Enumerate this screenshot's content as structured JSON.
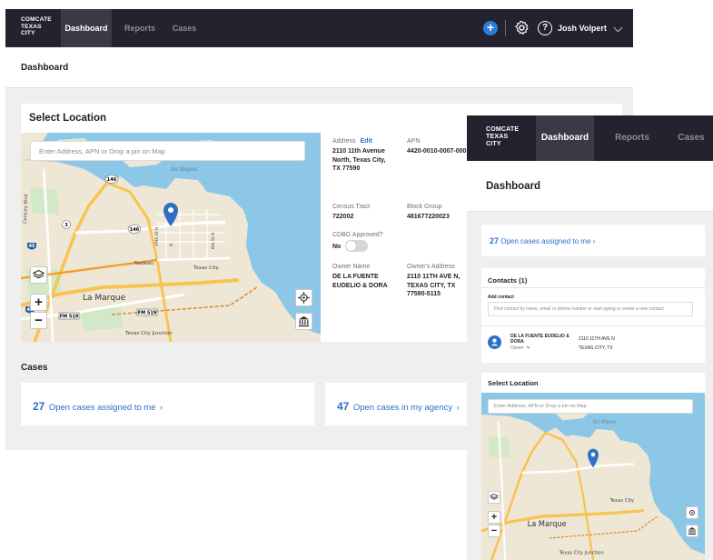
{
  "brand": {
    "line1": "COMCATE",
    "line2": "TEXAS",
    "line3": "CITY"
  },
  "nav": {
    "dashboard": "Dashboard",
    "reports": "Reports",
    "cases": "Cases"
  },
  "user": {
    "name": "Josh Volpert"
  },
  "icons": {
    "add": "plus-circle-icon",
    "settings": "gear-icon",
    "help": "help-circle-icon",
    "menu": "chevron-down-icon"
  },
  "colors": {
    "accent": "#2a6fc9",
    "header_bg": "#23232f",
    "water": "#8cc7e8",
    "land": "#efe7d6"
  },
  "page": {
    "title": "Dashboard"
  },
  "select_location": {
    "title": "Select Location",
    "search_placeholder": "Enter Address, APN or Drop a pin on Map",
    "map_labels": {
      "sis_bayou": "Sis Bayou",
      "la_marque": "La Marque",
      "nadeau": "Nadeau",
      "texas_city": "Texas City",
      "texas_city_junction": "Texas City Junction",
      "century_blvd": "Century Blvd",
      "fm519": "FM 519",
      "fm519b": "FM 519",
      "hwy146": "146",
      "hwy146b": "146",
      "hwy3": "3",
      "i45": "45",
      "i45b": "45",
      "street_29th": "29th St N",
      "street_n": "N",
      "street_6th": "6th St N"
    },
    "zoom_in": "+",
    "zoom_out": "−",
    "layers_icon": "layers-icon",
    "locate_icon": "crosshair-icon",
    "parcel_icon": "building-icon"
  },
  "property": {
    "address_label": "Address",
    "edit_label": "Edit",
    "address_value": "2110 11th Avenue North, Texas City, TX 77590",
    "apn_label": "APN",
    "apn_value": "4420-0010-0007-000",
    "census_label": "Census Tract",
    "census_value": "722002",
    "block_label": "Block Group",
    "block_value": "481677220023",
    "cdbg_label": "CDBG Approved?",
    "cdbg_value": "No",
    "owner_label": "Owner Name",
    "owner_value": "DE LA FUENTE EUDELIO & DORA",
    "owner_address_label": "Owner's Address",
    "owner_address_value": "2110 11TH AVE N, TEXAS CITY, TX 77590-5115"
  },
  "cases": {
    "title": "Cases",
    "assigned_count": "27",
    "assigned_label": "Open cases assigned to me",
    "agency_count": "47",
    "agency_label": "Open cases in my agency",
    "arrow": "›"
  },
  "mobile": {
    "assigned_count": "27",
    "assigned_label": "Open cases assigned to me",
    "contacts_title": "Contacts (1)",
    "add_contact_label": "Add contact",
    "add_contact_placeholder": "Find contact by name, email or phone number or start typing to create a new contact",
    "contact_name": "DE LA FUENTE EUDELIO & DORA",
    "contact_role": "Owner",
    "contact_address_line1": "2110 11TH AVE N",
    "contact_address_line2": "TEXAS CITY, TX"
  }
}
